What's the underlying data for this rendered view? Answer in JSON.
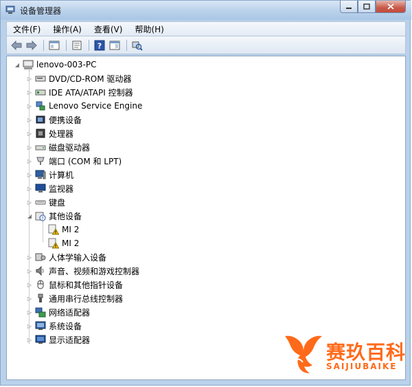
{
  "window": {
    "title": "设备管理器",
    "controls": {
      "minimize_icon": "minimize-icon",
      "maximize_icon": "maximize-icon",
      "close_icon": "close-icon"
    }
  },
  "menu": [
    {
      "label": "文件(F)"
    },
    {
      "label": "操作(A)"
    },
    {
      "label": "查看(V)"
    },
    {
      "label": "帮助(H)"
    }
  ],
  "toolbar": [
    "back-arrow-icon",
    "forward-arrow-icon",
    "show-hide-console-tree-icon",
    "properties-icon",
    "help-icon",
    "action-pane-icon",
    "scan-hardware-changes-icon"
  ],
  "tree": {
    "root": {
      "label": "lenovo-003-PC",
      "icon": "computer-icon",
      "expanded": true
    },
    "items": [
      {
        "label": "DVD/CD-ROM 驱动器",
        "icon": "dvd-drive-icon",
        "expanded": false
      },
      {
        "label": "IDE ATA/ATAPI 控制器",
        "icon": "ide-controller-icon",
        "expanded": false
      },
      {
        "label": "Lenovo Service Engine",
        "icon": "network-device-icon",
        "expanded": false
      },
      {
        "label": "便携设备",
        "icon": "portable-device-icon",
        "expanded": false
      },
      {
        "label": "处理器",
        "icon": "processor-icon",
        "expanded": false
      },
      {
        "label": "磁盘驱动器",
        "icon": "disk-drive-icon",
        "expanded": false
      },
      {
        "label": "端口 (COM 和 LPT)",
        "icon": "port-icon",
        "expanded": false
      },
      {
        "label": "计算机",
        "icon": "computer-monitor-icon",
        "expanded": false
      },
      {
        "label": "监视器",
        "icon": "monitor-icon",
        "expanded": false
      },
      {
        "label": "键盘",
        "icon": "keyboard-icon",
        "expanded": false
      },
      {
        "label": "其他设备",
        "icon": "unknown-device-icon",
        "expanded": true,
        "children": [
          {
            "label": "MI 2",
            "icon": "warning-device-icon"
          },
          {
            "label": "MI 2",
            "icon": "warning-device-icon"
          }
        ]
      },
      {
        "label": "人体学输入设备",
        "icon": "hid-icon",
        "expanded": false
      },
      {
        "label": "声音、视频和游戏控制器",
        "icon": "speaker-icon",
        "expanded": false
      },
      {
        "label": "鼠标和其他指针设备",
        "icon": "mouse-icon",
        "expanded": false
      },
      {
        "label": "通用串行总线控制器",
        "icon": "usb-icon",
        "expanded": false
      },
      {
        "label": "网络适配器",
        "icon": "network-adapter-icon",
        "expanded": false
      },
      {
        "label": "系统设备",
        "icon": "system-device-icon",
        "expanded": false
      },
      {
        "label": "显示适配器",
        "icon": "display-adapter-icon",
        "expanded": false
      }
    ]
  },
  "watermark": {
    "brand": "赛玖百科",
    "sub": "SAIJIUBAIKE",
    "color": "#ff6a1a"
  },
  "colors": {
    "title_bar": "#bcd3ec",
    "warning": "#f5c400",
    "accent": "#3a6ea5"
  }
}
